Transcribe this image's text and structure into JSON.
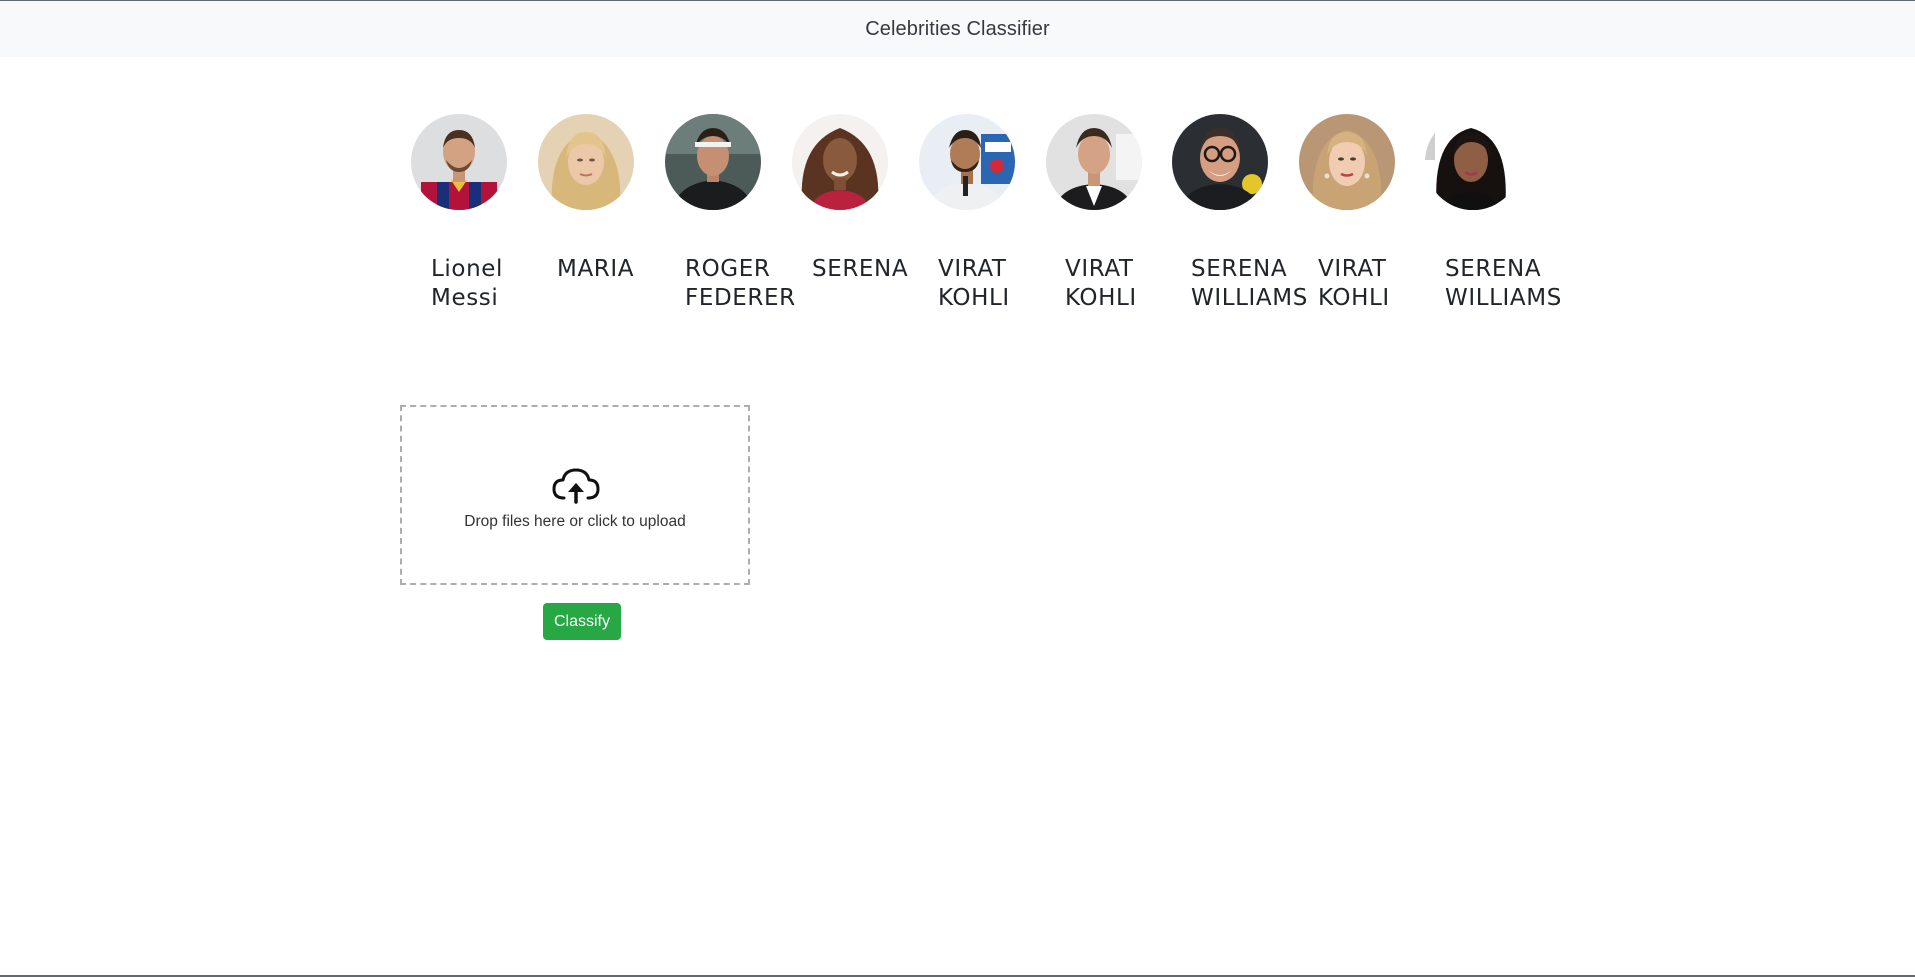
{
  "app": {
    "title": "Celebrities Classifier"
  },
  "celebrities": [
    {
      "name": "Lionel Messi"
    },
    {
      "name": "MARIA"
    },
    {
      "name": "ROGER FEDERER"
    },
    {
      "name": "SERENA"
    },
    {
      "name": "VIRAT KOHLI"
    },
    {
      "name": "VIRAT KOHLI"
    },
    {
      "name": "SERENA WILLIAMS"
    },
    {
      "name": "VIRAT KOHLI"
    },
    {
      "name": "SERENA WILLIAMS"
    }
  ],
  "upload": {
    "message": "Drop files here or click to upload",
    "icon": "cloud-upload-icon"
  },
  "actions": {
    "classify_label": "Classify"
  },
  "colors": {
    "navbar_bg": "#f8f9fa",
    "accent_green": "#28a745",
    "dropzone_border": "#adadad"
  }
}
